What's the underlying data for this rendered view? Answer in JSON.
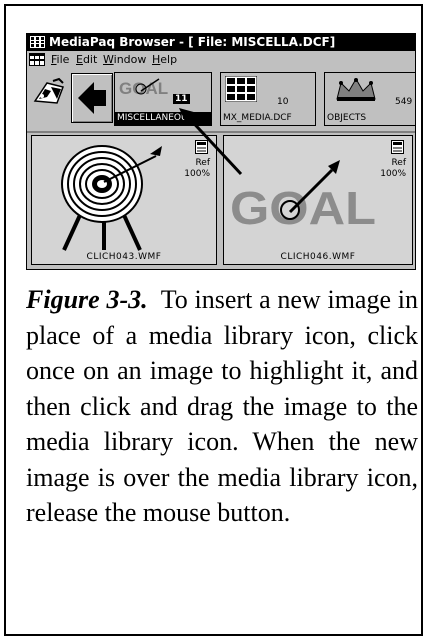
{
  "window": {
    "title": "MediaPaq Browser - [ File: MISCELLA.DCF]"
  },
  "menu": {
    "items": [
      "File",
      "Edit",
      "Window",
      "Help"
    ]
  },
  "toolbar": {
    "libraries": [
      {
        "label": "MISCELLANEOUS",
        "count": "11",
        "selected": true
      },
      {
        "label": "MX_MEDIA.DCF",
        "count": "10",
        "selected": false
      },
      {
        "label": "OBJECTS",
        "count": "549",
        "selected": false
      }
    ]
  },
  "images": [
    {
      "filename": "CLICH043.WMF",
      "ref_label": "Ref",
      "ref_value": "100%"
    },
    {
      "filename": "CLICH046.WMF",
      "ref_label": "Ref",
      "ref_value": "100%",
      "logo_text": "GOAL"
    }
  ],
  "caption": {
    "figure_label": "Figure 3-3.",
    "text": "To insert a new image in place of a media library icon, click once on an image to highlight it, and then click and drag the image to the media library icon. When the new image is over the media library icon, release the mouse button."
  }
}
